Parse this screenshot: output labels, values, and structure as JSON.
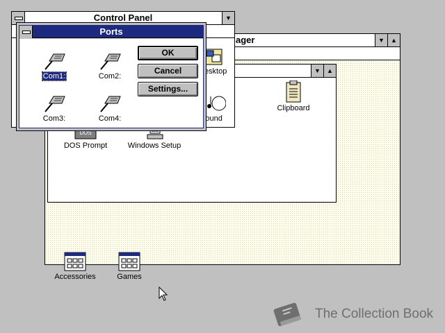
{
  "program_manager": {
    "title": "Program Manager"
  },
  "main_group": {
    "icons": [
      {
        "label": "DOS Prompt"
      },
      {
        "label": "Windows Setup"
      },
      {
        "label": "Clipboard"
      }
    ]
  },
  "program_groups": [
    {
      "label": "Accessories"
    },
    {
      "label": "Games"
    }
  ],
  "control_panel": {
    "title": "Control Panel",
    "icons": [
      {
        "label": "Desktop"
      },
      {
        "label": "Sound"
      }
    ]
  },
  "ports_dialog": {
    "title": "Ports",
    "ports": [
      {
        "label": "Com1:"
      },
      {
        "label": "Com2:"
      },
      {
        "label": "Com3:"
      },
      {
        "label": "Com4:"
      }
    ],
    "buttons": {
      "ok": "OK",
      "cancel": "Cancel",
      "settings": "Settings..."
    }
  },
  "watermark": {
    "text": "The Collection Book"
  },
  "colors": {
    "active_title": "#1e2a80",
    "desktop": "#c0c0c0",
    "window_bg": "#fffff0"
  }
}
